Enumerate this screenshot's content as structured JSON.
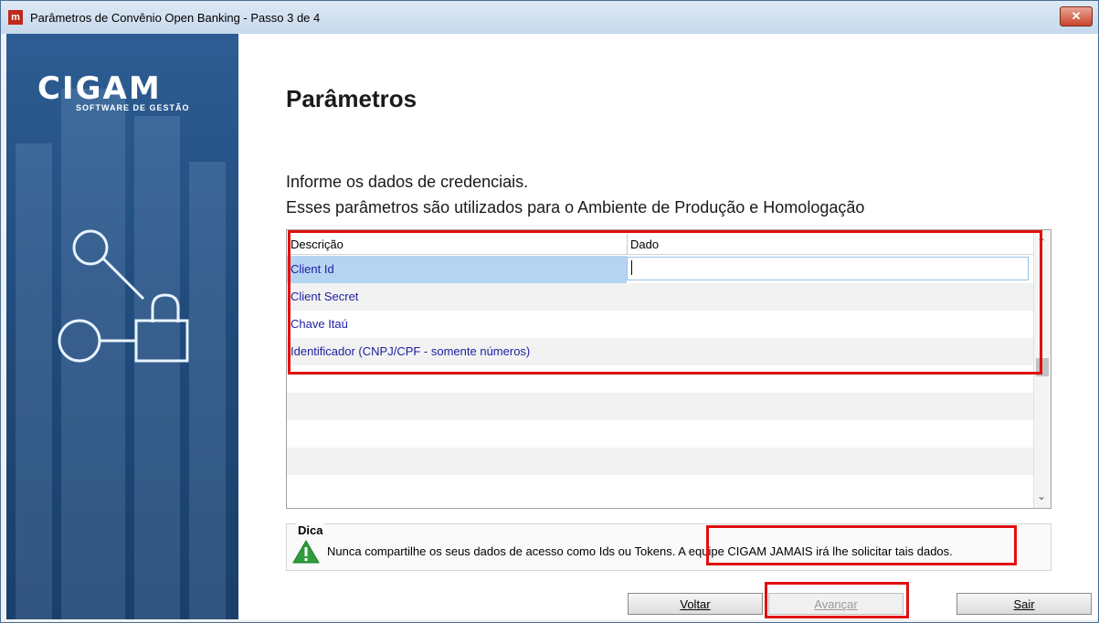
{
  "window": {
    "title": "Parâmetros de Convênio Open Banking - Passo 3 de 4",
    "close_label": "✕"
  },
  "sidebar": {
    "logo_main": "CIGAM",
    "logo_sub": "SOFTWARE DE GESTÃO"
  },
  "page": {
    "heading": "Parâmetros",
    "info_line1": "Informe os dados de credenciais.",
    "info_line2": "Esses parâmetros são utilizados para o Ambiente de Produção e Homologação"
  },
  "grid": {
    "columns": [
      "Descrição",
      "Dado"
    ],
    "rows": [
      {
        "label": "Client Id",
        "value": ""
      },
      {
        "label": "Client Secret",
        "value": ""
      },
      {
        "label": "Chave Itaú",
        "value": ""
      },
      {
        "label": "Identificador (CNPJ/CPF - somente números)",
        "value": ""
      }
    ]
  },
  "tip": {
    "title": "Dica",
    "text": "Nunca compartilhe os seus dados de acesso como Ids ou Tokens. A equipe CIGAM JAMAIS irá lhe solicitar tais dados."
  },
  "buttons": {
    "back": "Voltar",
    "next": "Avançar",
    "exit": "Sair"
  },
  "colors": {
    "highlight": "#e01010",
    "selected_row": "#b4d4f2",
    "link_text": "#1e1e9e"
  }
}
